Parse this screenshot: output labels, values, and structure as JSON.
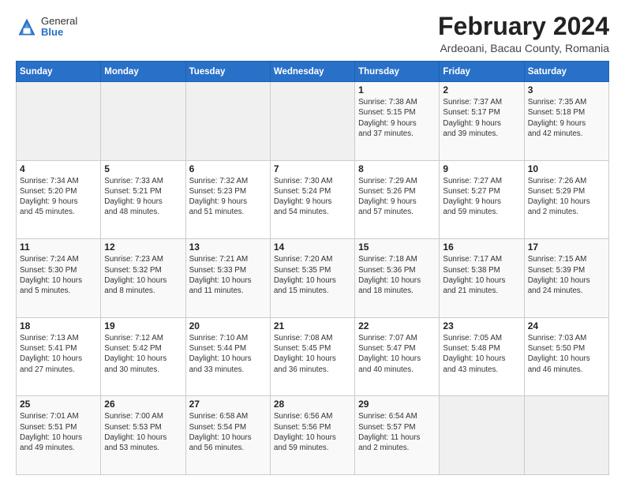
{
  "header": {
    "logo_general": "General",
    "logo_blue": "Blue",
    "month_year": "February 2024",
    "location": "Ardeoani, Bacau County, Romania"
  },
  "weekdays": [
    "Sunday",
    "Monday",
    "Tuesday",
    "Wednesday",
    "Thursday",
    "Friday",
    "Saturday"
  ],
  "weeks": [
    [
      {
        "day": "",
        "info": ""
      },
      {
        "day": "",
        "info": ""
      },
      {
        "day": "",
        "info": ""
      },
      {
        "day": "",
        "info": ""
      },
      {
        "day": "1",
        "info": "Sunrise: 7:38 AM\nSunset: 5:15 PM\nDaylight: 9 hours\nand 37 minutes."
      },
      {
        "day": "2",
        "info": "Sunrise: 7:37 AM\nSunset: 5:17 PM\nDaylight: 9 hours\nand 39 minutes."
      },
      {
        "day": "3",
        "info": "Sunrise: 7:35 AM\nSunset: 5:18 PM\nDaylight: 9 hours\nand 42 minutes."
      }
    ],
    [
      {
        "day": "4",
        "info": "Sunrise: 7:34 AM\nSunset: 5:20 PM\nDaylight: 9 hours\nand 45 minutes."
      },
      {
        "day": "5",
        "info": "Sunrise: 7:33 AM\nSunset: 5:21 PM\nDaylight: 9 hours\nand 48 minutes."
      },
      {
        "day": "6",
        "info": "Sunrise: 7:32 AM\nSunset: 5:23 PM\nDaylight: 9 hours\nand 51 minutes."
      },
      {
        "day": "7",
        "info": "Sunrise: 7:30 AM\nSunset: 5:24 PM\nDaylight: 9 hours\nand 54 minutes."
      },
      {
        "day": "8",
        "info": "Sunrise: 7:29 AM\nSunset: 5:26 PM\nDaylight: 9 hours\nand 57 minutes."
      },
      {
        "day": "9",
        "info": "Sunrise: 7:27 AM\nSunset: 5:27 PM\nDaylight: 9 hours\nand 59 minutes."
      },
      {
        "day": "10",
        "info": "Sunrise: 7:26 AM\nSunset: 5:29 PM\nDaylight: 10 hours\nand 2 minutes."
      }
    ],
    [
      {
        "day": "11",
        "info": "Sunrise: 7:24 AM\nSunset: 5:30 PM\nDaylight: 10 hours\nand 5 minutes."
      },
      {
        "day": "12",
        "info": "Sunrise: 7:23 AM\nSunset: 5:32 PM\nDaylight: 10 hours\nand 8 minutes."
      },
      {
        "day": "13",
        "info": "Sunrise: 7:21 AM\nSunset: 5:33 PM\nDaylight: 10 hours\nand 11 minutes."
      },
      {
        "day": "14",
        "info": "Sunrise: 7:20 AM\nSunset: 5:35 PM\nDaylight: 10 hours\nand 15 minutes."
      },
      {
        "day": "15",
        "info": "Sunrise: 7:18 AM\nSunset: 5:36 PM\nDaylight: 10 hours\nand 18 minutes."
      },
      {
        "day": "16",
        "info": "Sunrise: 7:17 AM\nSunset: 5:38 PM\nDaylight: 10 hours\nand 21 minutes."
      },
      {
        "day": "17",
        "info": "Sunrise: 7:15 AM\nSunset: 5:39 PM\nDaylight: 10 hours\nand 24 minutes."
      }
    ],
    [
      {
        "day": "18",
        "info": "Sunrise: 7:13 AM\nSunset: 5:41 PM\nDaylight: 10 hours\nand 27 minutes."
      },
      {
        "day": "19",
        "info": "Sunrise: 7:12 AM\nSunset: 5:42 PM\nDaylight: 10 hours\nand 30 minutes."
      },
      {
        "day": "20",
        "info": "Sunrise: 7:10 AM\nSunset: 5:44 PM\nDaylight: 10 hours\nand 33 minutes."
      },
      {
        "day": "21",
        "info": "Sunrise: 7:08 AM\nSunset: 5:45 PM\nDaylight: 10 hours\nand 36 minutes."
      },
      {
        "day": "22",
        "info": "Sunrise: 7:07 AM\nSunset: 5:47 PM\nDaylight: 10 hours\nand 40 minutes."
      },
      {
        "day": "23",
        "info": "Sunrise: 7:05 AM\nSunset: 5:48 PM\nDaylight: 10 hours\nand 43 minutes."
      },
      {
        "day": "24",
        "info": "Sunrise: 7:03 AM\nSunset: 5:50 PM\nDaylight: 10 hours\nand 46 minutes."
      }
    ],
    [
      {
        "day": "25",
        "info": "Sunrise: 7:01 AM\nSunset: 5:51 PM\nDaylight: 10 hours\nand 49 minutes."
      },
      {
        "day": "26",
        "info": "Sunrise: 7:00 AM\nSunset: 5:53 PM\nDaylight: 10 hours\nand 53 minutes."
      },
      {
        "day": "27",
        "info": "Sunrise: 6:58 AM\nSunset: 5:54 PM\nDaylight: 10 hours\nand 56 minutes."
      },
      {
        "day": "28",
        "info": "Sunrise: 6:56 AM\nSunset: 5:56 PM\nDaylight: 10 hours\nand 59 minutes."
      },
      {
        "day": "29",
        "info": "Sunrise: 6:54 AM\nSunset: 5:57 PM\nDaylight: 11 hours\nand 2 minutes."
      },
      {
        "day": "",
        "info": ""
      },
      {
        "day": "",
        "info": ""
      }
    ]
  ]
}
